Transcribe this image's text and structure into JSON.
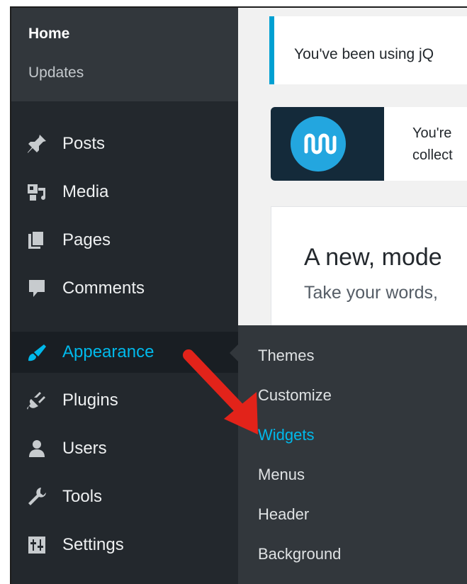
{
  "sidebar": {
    "submenu_top": {
      "home": "Home",
      "updates": "Updates"
    },
    "items": [
      {
        "label": "Posts",
        "icon": "pushpin-icon"
      },
      {
        "label": "Media",
        "icon": "media-icon"
      },
      {
        "label": "Pages",
        "icon": "pages-icon"
      },
      {
        "label": "Comments",
        "icon": "comment-icon"
      },
      {
        "label": "Appearance",
        "icon": "paintbrush-icon",
        "active": true
      },
      {
        "label": "Plugins",
        "icon": "plugin-icon"
      },
      {
        "label": "Users",
        "icon": "user-icon"
      },
      {
        "label": "Tools",
        "icon": "wrench-icon"
      },
      {
        "label": "Settings",
        "icon": "settings-icon"
      }
    ]
  },
  "appearance_flyout": {
    "items": [
      "Themes",
      "Customize",
      "Widgets",
      "Menus",
      "Header",
      "Background"
    ],
    "current": "Widgets"
  },
  "content": {
    "notice_text": "You've been using jQ",
    "promo_line1": "You're",
    "promo_line2": "collect",
    "panel_heading": "A new, mode",
    "panel_sub": "Take your words,"
  },
  "colors": {
    "sidebar_bg": "#23282d",
    "submenu_bg": "#32373c",
    "accent": "#00b9eb",
    "annotation_arrow": "#e2231a"
  }
}
